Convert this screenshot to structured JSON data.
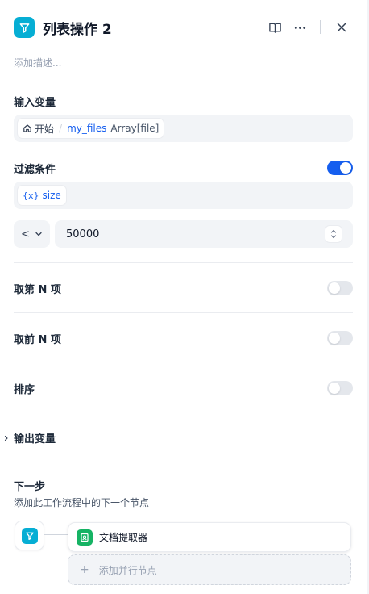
{
  "header": {
    "title": "列表操作 2",
    "description_placeholder": "添加描述...",
    "icons": {
      "node": "filter-icon",
      "docs": "book-open-icon",
      "more": "more-horizontal-icon",
      "close": "close-icon"
    }
  },
  "input_variable": {
    "label": "输入变量",
    "node_name": "开始",
    "separator": "/",
    "variable": "my_files",
    "type": "Array[file]"
  },
  "filter": {
    "label": "过滤条件",
    "enabled": true,
    "condition_var": "size",
    "condition_icon_text": "{x}",
    "operator": "<",
    "value": "50000"
  },
  "take_nth": {
    "label": "取第 N 项",
    "enabled": false
  },
  "take_first_n": {
    "label": "取前 N 项",
    "enabled": false
  },
  "sort": {
    "label": "排序",
    "enabled": false
  },
  "output_variable": {
    "label": "输出变量",
    "collapsed": true
  },
  "next_step": {
    "title": "下一步",
    "description": "添加此工作流程中的下一个节点",
    "next_node": {
      "label": "文档提取器",
      "icon": "document-extractor-icon"
    },
    "add_parallel_label": "添加并行节点",
    "add_parallel_icon_text": "+"
  },
  "colors": {
    "accent": "#155eef",
    "node_icon": "#06aed4",
    "doc_extractor_icon": "#16b364"
  }
}
